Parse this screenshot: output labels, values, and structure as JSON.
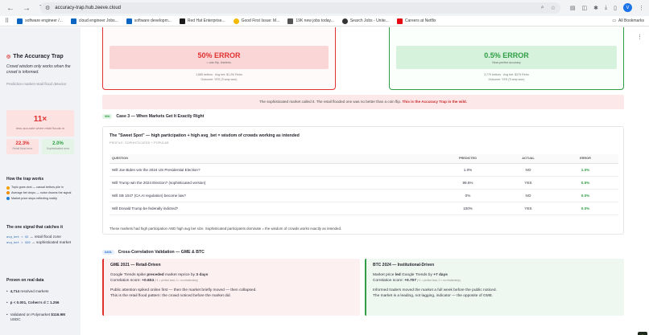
{
  "browser": {
    "url": "accuracy-trap.hub.zeeve.cloud",
    "avatar_letter": "V",
    "bookmarks": [
      {
        "label": "software engineer /...",
        "color": "#0a66c2"
      },
      {
        "label": "cloud engineer Jobs...",
        "color": "#0a66c2"
      },
      {
        "label": "software developm...",
        "color": "#0a66c2"
      },
      {
        "label": "Red Hat Enterprise...",
        "color": "#1a1a1a"
      },
      {
        "label": "Good First Issue: M...",
        "color": "#f5b800"
      },
      {
        "label": "19K new jobs today...",
        "color": "#555555"
      },
      {
        "label": "Search Jobs - Unite...",
        "color": "#333333"
      },
      {
        "label": "Careers at Netflix",
        "color": "#e50914"
      }
    ],
    "all_bookmarks": "All Bookmarks"
  },
  "sidebar": {
    "title": "The Accuracy Trap",
    "subtitle": "Crowd wisdom only works when the crowd is informed.",
    "detector": "Prediction market retail flood detector",
    "big_stat": {
      "value": "11×",
      "label": "less accurate when retail floods in"
    },
    "pct_cards": [
      {
        "value": "22.3%",
        "label": "Retail flood error",
        "tone": "red"
      },
      {
        "value": "2.0%",
        "label": "Sophisticated error",
        "tone": "green"
      }
    ],
    "how_title": "How the trap works",
    "how_items": [
      {
        "text": "Topic goes viral — casual bettors pile in",
        "color": "#f59f00"
      },
      {
        "text": "Average bet drops — noise drowns the signal",
        "color": "#f08c00"
      },
      {
        "text": "Market price stops reflecting reality",
        "color": "#1c7ed6"
      }
    ],
    "signal_title": "The one signal that catches it",
    "signal_lines": [
      {
        "code": "avg_bet < $5",
        "text": "→ retail flood zone"
      },
      {
        "code": "avg_bet > $50",
        "text": "→ sophisticated market"
      }
    ],
    "proof_title": "Proven on real data",
    "proof_items": [
      {
        "bold": "4,714",
        "text": " resolved markets"
      },
      {
        "bold": "p < 0.001, Cohen's d = 1.256",
        "text": ""
      },
      {
        "text": "Validated on Polymarket ",
        "bold": "$116.9M",
        "tail": " USDC"
      }
    ]
  },
  "main": {
    "error_left": {
      "big": "50% ERROR",
      "sub": "= coin flip. Useless.",
      "meta1": "1,685 bettors · Avg bet: $1.29/ Retro",
      "meta2": "Outcome: YES (Trump won)"
    },
    "error_right": {
      "big": "0.5% ERROR",
      "sub": "Near-perfect accuracy",
      "meta1": "3,779 bettors · Avg bet: $379 Retro",
      "meta2": "Outcome: YES (Trump won)"
    },
    "banner_text": "The sophisticated market called it. The retail flooded one was no better than a coin flip. ",
    "banner_bold": "This is the Accuracy Trap in the wild.",
    "case3": {
      "pill": "WIN",
      "heading": "Case 3 — When Markets Get It Exactly Right",
      "title": "The \"Sweet Spot\" — high participation + high avg_bet = wisdom of crowds working as intended",
      "profile": "PROFILE: SOPHISTICATED + POPULAR",
      "columns": [
        "QUESTION",
        "PREDICTED",
        "ACTUAL",
        "ERROR"
      ],
      "rows": [
        [
          "Will Joe Biden win the 2024 US Presidential Election?",
          "1.0%",
          "NO",
          "1.0%"
        ],
        [
          "Will Trump win the 2024 Election? (sophisticated version)",
          "99.5%",
          "YES",
          "0.5%"
        ],
        [
          "Will SB 1047 (CA AI regulation) become law?",
          "0%",
          "NO",
          "0.0%"
        ],
        [
          "Will Donald Trump be federally indicted?",
          "100%",
          "YES",
          "0.0%"
        ]
      ],
      "footer": "These markets had high participation AND high avg bet size. Sophisticated participants dominate = the wisdom of crowds works exactly as intended."
    },
    "cross": {
      "pill": "DATA",
      "heading": "Cross-Correlation Validation — GME & BTC",
      "gme": {
        "title": "GME 2021 — Retail-Driven",
        "l1a": "Google Trends spike ",
        "l1b": "preceded",
        "l1c": " market reprice by ",
        "l1d": "3 days",
        "l2a": "Correlation score: ",
        "l2b": "+0.604",
        "l2c": " (+1 = perfect lead, 0 = no relationship)",
        "l3": "Public attention spiked online first — then the market briefly moved — then collapsed.",
        "l4": "This is the retail flood pattern: the crowd noticed before the market did."
      },
      "btc": {
        "title": "BTC 2024 — Institutional-Driven",
        "l1a": "Market price ",
        "l1b": "led",
        "l1c": " Google Trends by ",
        "l1d": "+7 days",
        "l2a": "Correlation score: ",
        "l2b": "+0.707",
        "l2c": " (+1 = perfect lead, 0 = no relationship)",
        "l3": "Informed traders moved the market a full week before the public noticed.",
        "l4": "The market is a leading, not lagging, indicator — the opposite of GME."
      }
    }
  },
  "colors": {
    "red": "#e03131",
    "green": "#2f9e44",
    "blue": "#1c6bd1"
  }
}
